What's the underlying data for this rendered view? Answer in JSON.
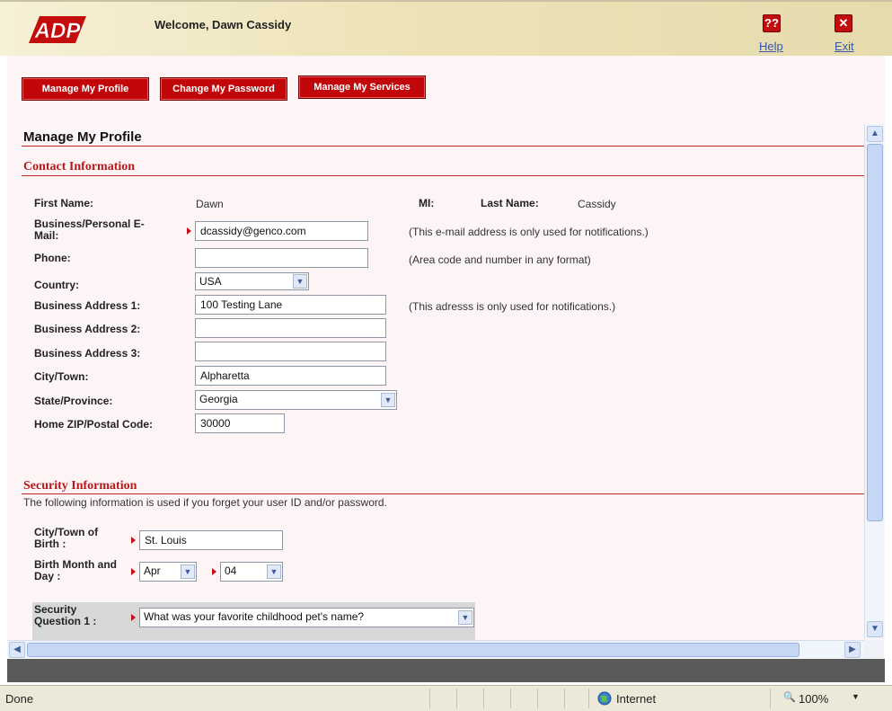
{
  "header": {
    "welcome": "Welcome, Dawn Cassidy",
    "help_icon": "??",
    "help_label": "Help",
    "exit_icon": "✕",
    "exit_label": "Exit"
  },
  "tabs": [
    {
      "label": "Manage My Profile"
    },
    {
      "label": "Change My Password"
    },
    {
      "label": "Manage My Services"
    }
  ],
  "page_title": "Manage My Profile",
  "contact": {
    "section_title": "Contact Information",
    "first_name_label": "First Name:",
    "first_name": "Dawn",
    "mi_label": "MI:",
    "last_name_label": "Last Name:",
    "last_name": "Cassidy",
    "email_label": "Business/Personal E-Mail:",
    "email": "dcassidy@genco.com",
    "email_note": "(This e-mail address is only used for notifications.)",
    "phone_label": "Phone:",
    "phone": "",
    "phone_note": "(Area code and number in any format)",
    "country_label": "Country:",
    "country": "USA",
    "addr1_label": "Business Address 1:",
    "addr1": "100 Testing Lane",
    "addr1_note": "(This adresss is only used for notifications.)",
    "addr2_label": "Business Address 2:",
    "addr2": "",
    "addr3_label": "Business Address 3:",
    "addr3": "",
    "city_label": "City/Town:",
    "city": "Alpharetta",
    "state_label": "State/Province:",
    "state": "Georgia",
    "zip_label": "Home ZIP/Postal Code:",
    "zip": "30000"
  },
  "security": {
    "section_title": "Security Information",
    "description": "The following information is used if you forget your user ID and/or password.",
    "birth_city_label": "City/Town of Birth :",
    "birth_city": "St. Louis",
    "birth_md_label": "Birth Month and Day :",
    "birth_month": "Apr",
    "birth_day": "04",
    "q1_label": "Security Question 1 :",
    "q1": "What was your favorite childhood pet's name?"
  },
  "statusbar": {
    "status": "Done",
    "zone": "Internet",
    "zoom": "100%"
  },
  "colors": {
    "brand_red": "#c1070a",
    "content_bg": "#fdf5f5"
  }
}
